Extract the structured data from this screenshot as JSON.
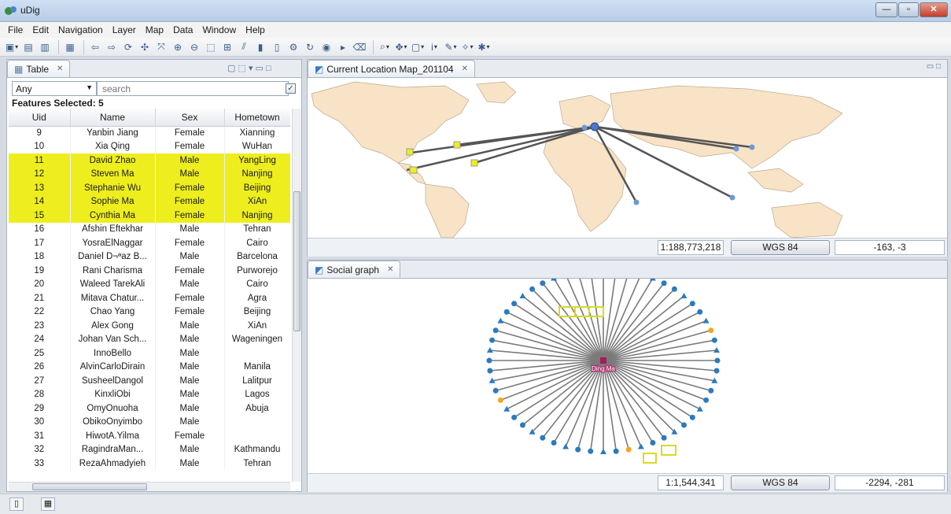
{
  "window": {
    "title": "uDig"
  },
  "menu": [
    "File",
    "Edit",
    "Navigation",
    "Layer",
    "Map",
    "Data",
    "Window",
    "Help"
  ],
  "table_panel": {
    "tab_label": "Table",
    "filter_value": "Any",
    "search_placeholder": "search",
    "features_selected": "Features Selected: 5",
    "columns": [
      "Uid",
      "Name",
      "Sex",
      "Hometown"
    ],
    "rows": [
      {
        "uid": "9",
        "name": "Yanbin Jiang",
        "sex": "Female",
        "hometown": "Xianning",
        "selected": false
      },
      {
        "uid": "10",
        "name": "Xia Qing",
        "sex": "Female",
        "hometown": "WuHan",
        "selected": false
      },
      {
        "uid": "11",
        "name": "David Zhao",
        "sex": "Male",
        "hometown": "YangLing",
        "selected": true
      },
      {
        "uid": "12",
        "name": "Steven Ma",
        "sex": "Male",
        "hometown": "Nanjing",
        "selected": true
      },
      {
        "uid": "13",
        "name": "Stephanie Wu",
        "sex": "Female",
        "hometown": "Beijing",
        "selected": true
      },
      {
        "uid": "14",
        "name": "Sophie Ma",
        "sex": "Female",
        "hometown": "XiAn",
        "selected": true
      },
      {
        "uid": "15",
        "name": "Cynthia Ma",
        "sex": "Female",
        "hometown": "Nanjing",
        "selected": true
      },
      {
        "uid": "16",
        "name": "Afshin Eftekhar",
        "sex": "Male",
        "hometown": "Tehran",
        "selected": false
      },
      {
        "uid": "17",
        "name": "YosraElNaggar",
        "sex": "Female",
        "hometown": "Cairo",
        "selected": false
      },
      {
        "uid": "18",
        "name": "Daniel D¬ªaz B...",
        "sex": "Male",
        "hometown": "Barcelona",
        "selected": false
      },
      {
        "uid": "19",
        "name": "Rani Charisma",
        "sex": "Female",
        "hometown": "Purworejo",
        "selected": false
      },
      {
        "uid": "20",
        "name": "Waleed TarekAli",
        "sex": "Male",
        "hometown": "Cairo",
        "selected": false
      },
      {
        "uid": "21",
        "name": "Mitava Chatur...",
        "sex": "Female",
        "hometown": "Agra",
        "selected": false
      },
      {
        "uid": "22",
        "name": "Chao Yang",
        "sex": "Female",
        "hometown": "Beijing",
        "selected": false
      },
      {
        "uid": "23",
        "name": "Alex Gong",
        "sex": "Male",
        "hometown": "XiAn",
        "selected": false
      },
      {
        "uid": "24",
        "name": "Johan Van Sch...",
        "sex": "Male",
        "hometown": "Wageningen",
        "selected": false
      },
      {
        "uid": "25",
        "name": "InnoBello",
        "sex": "Male",
        "hometown": "",
        "selected": false
      },
      {
        "uid": "26",
        "name": "AlvinCarloDirain",
        "sex": "Male",
        "hometown": "Manila",
        "selected": false
      },
      {
        "uid": "27",
        "name": "SusheelDangol",
        "sex": "Male",
        "hometown": "Lalitpur",
        "selected": false
      },
      {
        "uid": "28",
        "name": "KinxliObi",
        "sex": "Male",
        "hometown": "Lagos",
        "selected": false
      },
      {
        "uid": "29",
        "name": "OmyOnuoha",
        "sex": "Male",
        "hometown": "Abuja",
        "selected": false
      },
      {
        "uid": "30",
        "name": "ObikoOnyimbo",
        "sex": "Male",
        "hometown": "",
        "selected": false
      },
      {
        "uid": "31",
        "name": "HiwotA.Yilma",
        "sex": "Female",
        "hometown": "",
        "selected": false
      },
      {
        "uid": "32",
        "name": "RagindraMan...",
        "sex": "Male",
        "hometown": "Kathmandu",
        "selected": false
      },
      {
        "uid": "33",
        "name": "RezaAhmadyieh",
        "sex": "Male",
        "hometown": "Tehran",
        "selected": false
      }
    ]
  },
  "map_panel": {
    "tab_label": "Current Location Map_201104",
    "scale": "1:188,773,218",
    "crs": "WGS 84",
    "coords": "-163, -3"
  },
  "graph_panel": {
    "tab_label": "Social graph",
    "center_label": "Ding Ma",
    "scale": "1:1,544,341",
    "crs": "WGS 84",
    "coords": "-2294, -281"
  },
  "colors": {
    "selection": "#eeee1e",
    "land": "#f8e3c6",
    "node_blue": "#2b7bbd",
    "node_orange": "#f5a623",
    "edge": "#7a7a7a"
  }
}
